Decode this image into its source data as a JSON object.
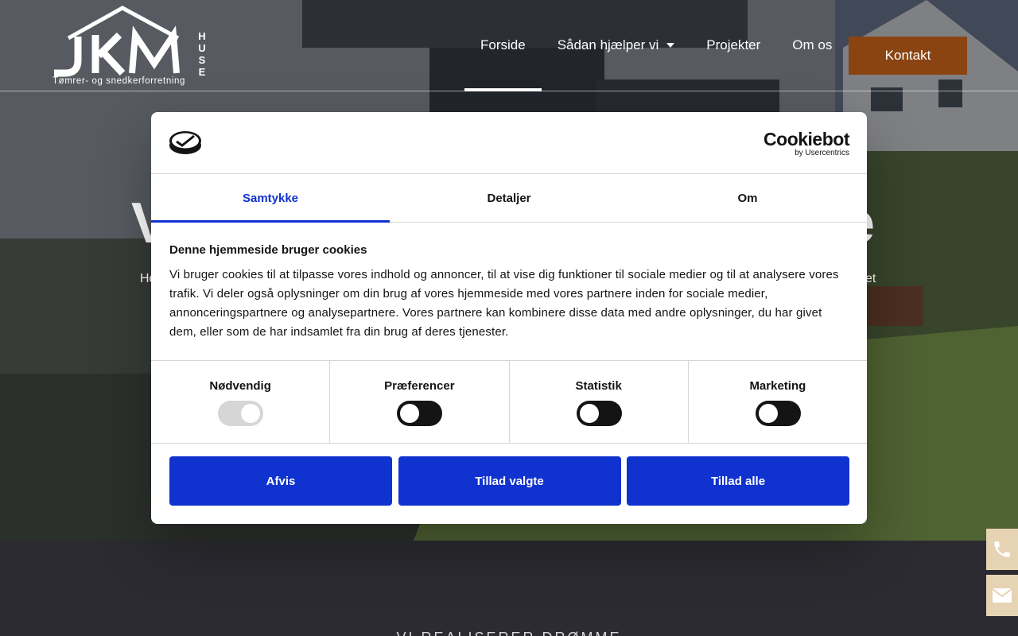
{
  "header": {
    "logo_text": "JKM",
    "logo_side": "HUSE",
    "logo_tagline": "Tømrer- og snedkerforretning",
    "nav": [
      {
        "label": "Forside",
        "active": true
      },
      {
        "label": "Sådan hjælper vi",
        "has_dropdown": true
      },
      {
        "label": "Projekter"
      },
      {
        "label": "Om os"
      }
    ],
    "contact_button": "Kontakt",
    "contact_color": "#8a4412"
  },
  "hero": {
    "title_left": "V",
    "title_right": "e",
    "subtitle_left": "Ho",
    "subtitle_right": "et"
  },
  "side_tabs": [
    {
      "icon": "phone-icon"
    },
    {
      "icon": "envelope-icon"
    }
  ],
  "bottom": {
    "teaser": "VI REALISERER DRØMME"
  },
  "cookie_dialog": {
    "brand": "Cookiebot",
    "brand_sub": "by Usercentrics",
    "tabs": [
      {
        "label": "Samtykke",
        "active": true
      },
      {
        "label": "Detaljer"
      },
      {
        "label": "Om"
      }
    ],
    "title": "Denne hjemmeside bruger cookies",
    "text": "Vi bruger cookies til at tilpasse vores indhold og annoncer, til at vise dig funktioner til sociale medier og til at analysere vores trafik. Vi deler også oplysninger om din brug af vores hjemmeside med vores partnere inden for sociale medier, annonceringspartnere og analysepartnere. Vores partnere kan kombinere disse data med andre oplysninger, du har givet dem, eller som de har indsamlet fra din brug af deres tjenester.",
    "categories": [
      {
        "label": "Nødvendig",
        "checked": true,
        "disabled": true
      },
      {
        "label": "Præferencer",
        "checked": false
      },
      {
        "label": "Statistik",
        "checked": false
      },
      {
        "label": "Marketing",
        "checked": false
      }
    ],
    "buttons": {
      "deny": "Afvis",
      "allow_selected": "Tillad valgte",
      "allow_all": "Tillad alle"
    },
    "accent_color": "#1032cf"
  }
}
